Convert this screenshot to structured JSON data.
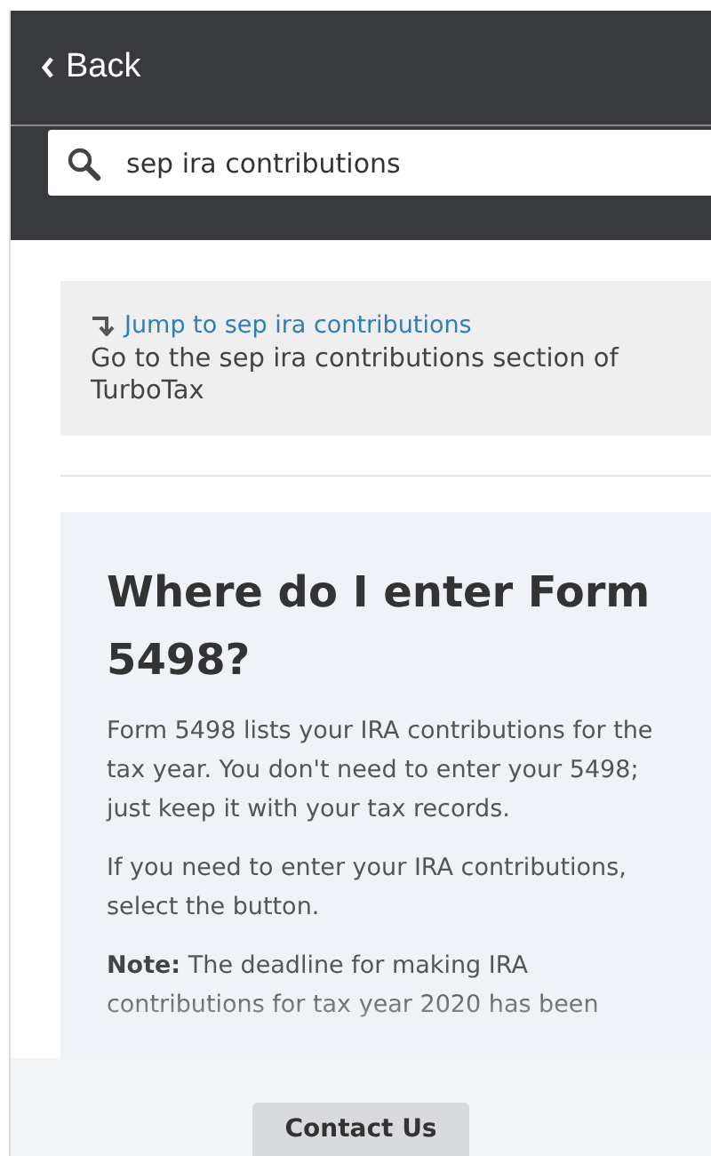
{
  "header": {
    "back_label": "Back"
  },
  "search": {
    "value": "sep ira contributions"
  },
  "jump_card": {
    "link": "Jump to sep ira contributions",
    "description": "Go to the sep ira contributions section of TurboTax"
  },
  "article": {
    "title": "Where do I enter Form 5498?",
    "paragraphs": [
      "Form 5498 lists your IRA contributions for the tax year. You don't need to enter your 5498; just keep it with your tax records.",
      "If you need to enter your IRA contributions, select the button.",
      "**Note:** The deadline for making IRA contributions for tax year 2020 has been"
    ]
  },
  "footer": {
    "button": "Contact Us"
  }
}
